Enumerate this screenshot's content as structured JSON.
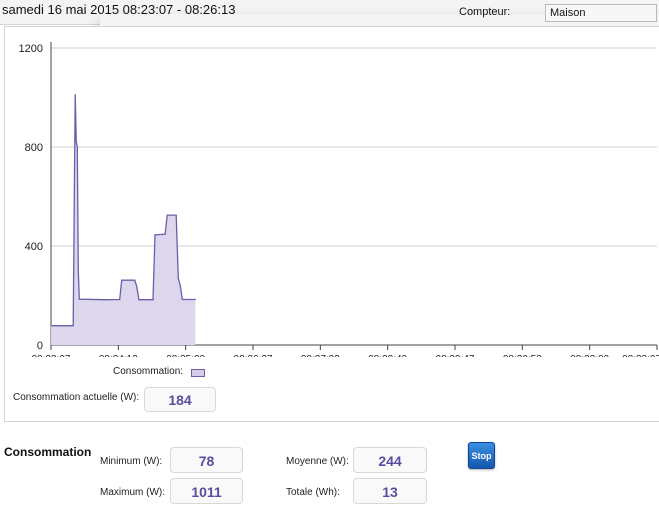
{
  "header": {
    "date_range": "samedi 16 mai 2015 08:23:07 - 08:26:13",
    "counter_label": "Compteur:",
    "counter_value": "Maison"
  },
  "chart_data": {
    "type": "area",
    "legend": "Consommation:",
    "ylim": [
      0,
      1200
    ],
    "y_ticks": [
      "0",
      "400",
      "800",
      "1200"
    ],
    "x_range_seconds": [
      0,
      600
    ],
    "x_ticks": [
      "08:23:07",
      "08:24:13",
      "08:25:20",
      "08:26:27",
      "08:27:33",
      "08:28:40",
      "08:29:47",
      "08:30:53",
      "08:32:00",
      "08:33:07"
    ],
    "series": [
      {
        "color": "#6a5fa8",
        "fill": "#ddd6ec",
        "points": [
          {
            "x": "08:23:07",
            "y": 78
          },
          {
            "x": "08:23:29",
            "y": 78
          },
          {
            "x": "08:23:31",
            "y": 1011
          },
          {
            "x": "08:23:32",
            "y": 820
          },
          {
            "x": "08:23:33",
            "y": 800
          },
          {
            "x": "08:23:34",
            "y": 300
          },
          {
            "x": "08:23:35",
            "y": 185
          },
          {
            "x": "08:24:00",
            "y": 183
          },
          {
            "x": "08:24:15",
            "y": 184
          },
          {
            "x": "08:24:17",
            "y": 262
          },
          {
            "x": "08:24:30",
            "y": 262
          },
          {
            "x": "08:24:32",
            "y": 235
          },
          {
            "x": "08:24:34",
            "y": 183
          },
          {
            "x": "08:24:48",
            "y": 183
          },
          {
            "x": "08:24:50",
            "y": 445
          },
          {
            "x": "08:25:00",
            "y": 448
          },
          {
            "x": "08:25:02",
            "y": 525
          },
          {
            "x": "08:25:11",
            "y": 525
          },
          {
            "x": "08:25:13",
            "y": 270
          },
          {
            "x": "08:25:15",
            "y": 240
          },
          {
            "x": "08:25:17",
            "y": 184
          },
          {
            "x": "08:25:30",
            "y": 184
          }
        ]
      }
    ]
  },
  "current": {
    "label": "Consommation actuelle (W):",
    "value": "184"
  },
  "stats": {
    "title": "Consommation",
    "min_label": "Minimum (W):",
    "min_value": "78",
    "avg_label": "Moyenne (W):",
    "avg_value": "244",
    "max_label": "Maximum (W):",
    "max_value": "1011",
    "total_label": "Totale (Wh):",
    "total_value": "13"
  },
  "stop_button": {
    "label": "Stop",
    "color": "#1f6fd0"
  }
}
